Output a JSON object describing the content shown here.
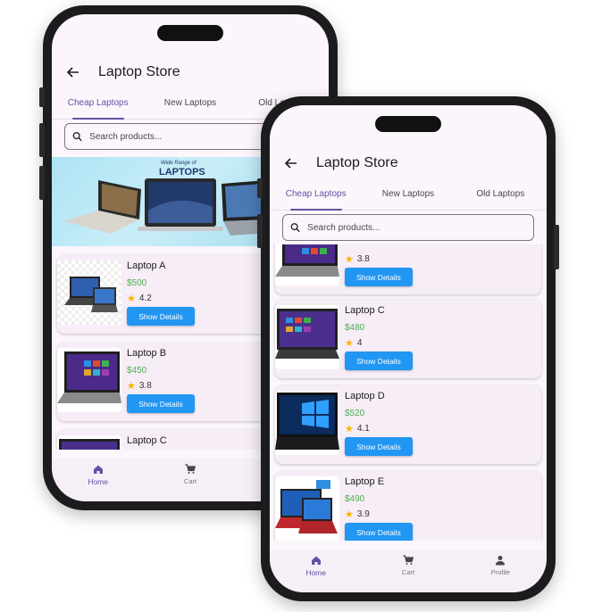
{
  "app": {
    "title": "Laptop Store"
  },
  "tabs": [
    {
      "label": "Cheap Laptops",
      "active": true
    },
    {
      "label": "New Laptops",
      "active": false
    },
    {
      "label": "Old Laptops",
      "active": false
    }
  ],
  "search": {
    "placeholder": "Search products..."
  },
  "banner": {
    "small_text": "Wide Range of",
    "big_text": "LAPTOPS"
  },
  "products": [
    {
      "name": "Laptop A",
      "price": "$500",
      "rating": "4.2",
      "button": "Show Details"
    },
    {
      "name": "Laptop B",
      "price": "$450",
      "rating": "3.8",
      "button": "Show Details"
    },
    {
      "name": "Laptop C",
      "price": "$480",
      "rating": "4",
      "button": "Show Details"
    },
    {
      "name": "Laptop D",
      "price": "$520",
      "rating": "4.1",
      "button": "Show Details"
    },
    {
      "name": "Laptop E",
      "price": "$490",
      "rating": "3.9",
      "button": "Show Details"
    }
  ],
  "nav": [
    {
      "label": "Home",
      "icon": "home-icon",
      "active": true
    },
    {
      "label": "Cart",
      "icon": "cart-icon",
      "active": false
    },
    {
      "label": "Profile",
      "icon": "person-icon",
      "active": false
    }
  ],
  "colors": {
    "accent": "#6750a4",
    "button": "#2196f3",
    "price": "#4caf50",
    "star": "#f5b400"
  }
}
